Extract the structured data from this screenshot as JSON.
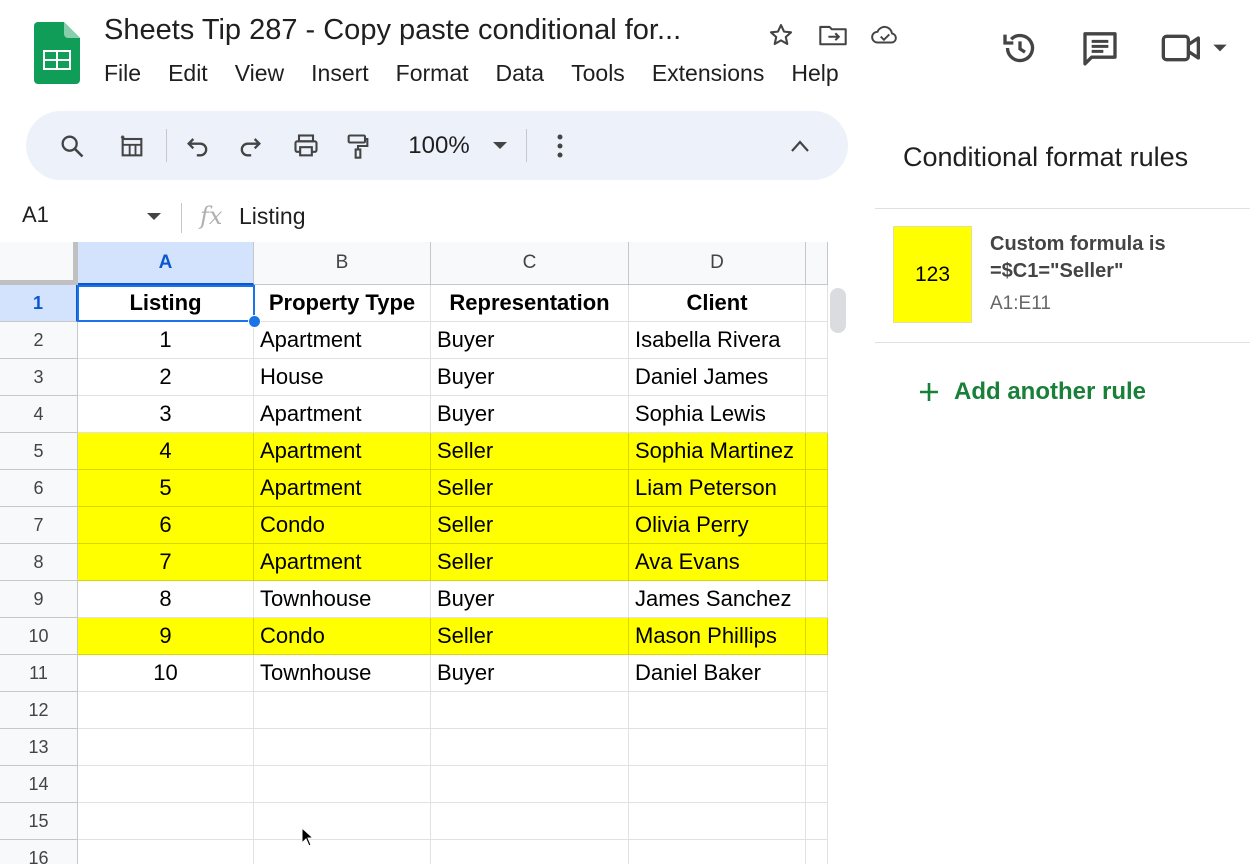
{
  "header": {
    "doc_title": "Sheets Tip 287 - Copy paste conditional for...",
    "title_icons": [
      "star-icon",
      "move-to-folder-icon",
      "cloud-saved-icon"
    ],
    "right_icons": [
      "version-history-icon",
      "comments-icon",
      "meet-icon"
    ]
  },
  "menu": {
    "file": "File",
    "edit": "Edit",
    "view": "View",
    "insert": "Insert",
    "format": "Format",
    "data": "Data",
    "tools": "Tools",
    "extensions": "Extensions",
    "help": "Help"
  },
  "toolbar": {
    "zoom": "100%",
    "icons": [
      "search-icon",
      "table-icon",
      "undo-icon",
      "redo-icon",
      "print-icon",
      "paint-format-icon",
      "more-icon",
      "collapse-icon"
    ]
  },
  "formula_bar": {
    "cell_ref": "A1",
    "fx": "fx",
    "content": "Listing"
  },
  "sheet": {
    "columns": [
      "A",
      "B",
      "C",
      "D"
    ],
    "row_numbers": [
      "1",
      "2",
      "3",
      "4",
      "5",
      "6",
      "7",
      "8",
      "9",
      "10",
      "11",
      "12",
      "13",
      "14",
      "15",
      "16"
    ],
    "header_row": [
      "Listing",
      "Property Type",
      "Representation",
      "Client"
    ],
    "rows": [
      [
        "1",
        "Apartment",
        "Buyer",
        "Isabella Rivera"
      ],
      [
        "2",
        "House",
        "Buyer",
        "Daniel James"
      ],
      [
        "3",
        "Apartment",
        "Buyer",
        "Sophia Lewis"
      ],
      [
        "4",
        "Apartment",
        "Seller",
        "Sophia Martinez"
      ],
      [
        "5",
        "Apartment",
        "Seller",
        "Liam Peterson"
      ],
      [
        "6",
        "Condo",
        "Seller",
        "Olivia Perry"
      ],
      [
        "7",
        "Apartment",
        "Seller",
        "Ava Evans"
      ],
      [
        "8",
        "Townhouse",
        "Buyer",
        "James Sanchez"
      ],
      [
        "9",
        "Condo",
        "Seller",
        "Mason Phillips"
      ],
      [
        "10",
        "Townhouse",
        "Buyer",
        "Daniel Baker"
      ]
    ],
    "highlight_color": "#ffff00",
    "selection_color": "#1a73e8"
  },
  "panel": {
    "title": "Conditional format rules",
    "rule": {
      "preview": "123",
      "type": "Custom formula is",
      "formula": "=$C1=\"Seller\"",
      "range": "A1:E11"
    },
    "add_rule": "Add another rule",
    "accent_color": "#188038"
  }
}
